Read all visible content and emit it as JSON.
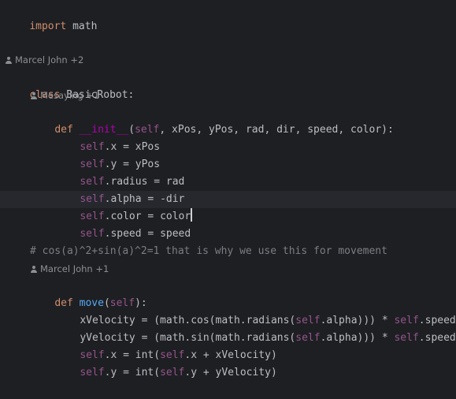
{
  "lines": {
    "l1": {
      "kw": "import",
      "rest": " math"
    },
    "author1": "Marcel John +2",
    "l2": {
      "kw": "class",
      "name": " BasicRobot",
      "rest": ":"
    },
    "author2": "Mesaying +1",
    "l3": {
      "kw": "def",
      "name": "__init__",
      "open": "(",
      "self": "self",
      "rest": ", xPos, yPos, rad, dir, speed, color):"
    },
    "l4": {
      "self": "self",
      "rest": ".x = xPos"
    },
    "l5": {
      "self": "self",
      "rest": ".y = yPos"
    },
    "l6": {
      "self": "self",
      "rest": ".radius = rad"
    },
    "l7": {
      "self": "self",
      "rest": ".alpha = -dir"
    },
    "l8": {
      "self": "self",
      "rest": ".color = color"
    },
    "l9": {
      "self": "self",
      "rest": ".speed = speed"
    },
    "comment": "# cos(a)^2+sin(a)^2=1 that is why we use this for movement",
    "author3": "Marcel John +1",
    "l10": {
      "kw": "def",
      "name": " move",
      "open": "(",
      "self": "self",
      "rest": "):"
    },
    "l11": {
      "pre": "xVelocity = (math.cos(math.radians(",
      "self": "self",
      "mid": ".alpha))) * ",
      "self2": "self",
      "rest": ".speed"
    },
    "l12": {
      "pre": "yVelocity = (math.sin(math.radians(",
      "self": "self",
      "mid": ".alpha))) * ",
      "self2": "self",
      "rest": ".speed"
    },
    "l13": {
      "self": "self",
      "pre": ".x = int(",
      "self2": "self",
      "rest": ".x + xVelocity)"
    },
    "l14": {
      "self": "self",
      "pre": ".y = int(",
      "self2": "self",
      "rest": ".y + yVelocity)"
    }
  },
  "icons": {
    "author": "person-icon",
    "caret": "text-caret"
  }
}
